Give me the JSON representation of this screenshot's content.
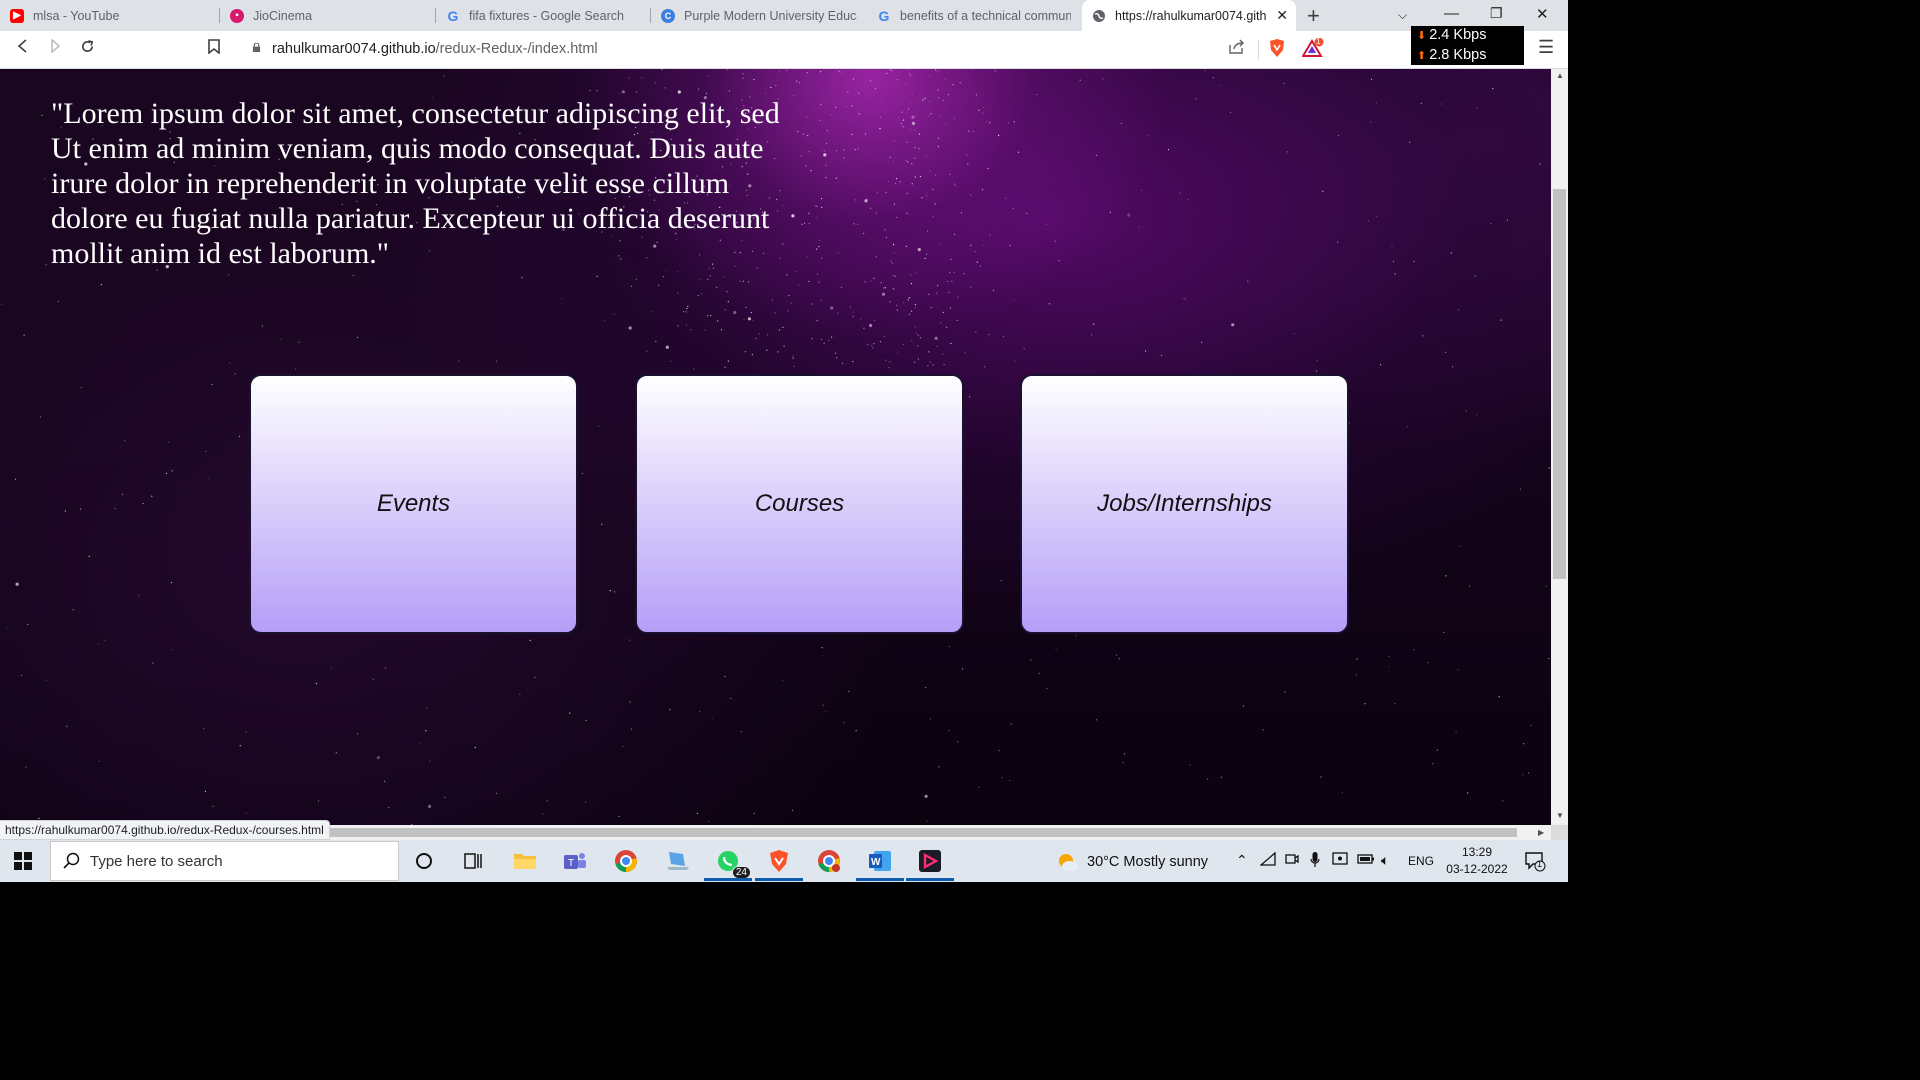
{
  "browser": {
    "tabs": [
      {
        "title": "mlsa - YouTube",
        "icon": "youtube-icon",
        "color": "#ff0000"
      },
      {
        "title": "JioCinema",
        "icon": "jiocinema-icon",
        "color": "#d9196b"
      },
      {
        "title": "fifa fixtures - Google Search",
        "icon": "google-icon",
        "color": "#4285f4"
      },
      {
        "title": "Purple Modern University Educat",
        "icon": "canva-icon",
        "color": "#3b7fe0"
      },
      {
        "title": "benefits of a technical communit",
        "icon": "google-icon",
        "color": "#4285f4"
      },
      {
        "title": "https://rahulkumar0074.gith",
        "icon": "globe-icon",
        "color": "#5f6368"
      }
    ],
    "active_tab_index": 5,
    "url_host": "rahulkumar0074.github.io",
    "url_path": "/redux-Redux-/index.html",
    "net_speed": {
      "down": "2.4 Kbps",
      "up": "2.8 Kbps"
    },
    "alert_count": "1",
    "status_url": "https://rahulkumar0074.github.io/redux-Redux-/courses.html"
  },
  "page": {
    "quote": "\"Lorem ipsum dolor sit amet, consectetur adipiscing elit, sed Ut enim ad minim veniam, quis modo consequat. Duis aute irure dolor in reprehenderit in voluptate velit esse cillum dolore eu fugiat nulla pariatur. Excepteur ui officia deserunt mollit anim id est laborum.\"",
    "cards": [
      {
        "label": "Events"
      },
      {
        "label": "Courses"
      },
      {
        "label": "Jobs/Internships"
      }
    ]
  },
  "taskbar": {
    "search_placeholder": "Type here to search",
    "whatsapp_badge": "24",
    "weather": "30°C  Mostly sunny",
    "language": "ENG",
    "time": "13:29",
    "date": "03-12-2022",
    "notification_count": "1"
  }
}
